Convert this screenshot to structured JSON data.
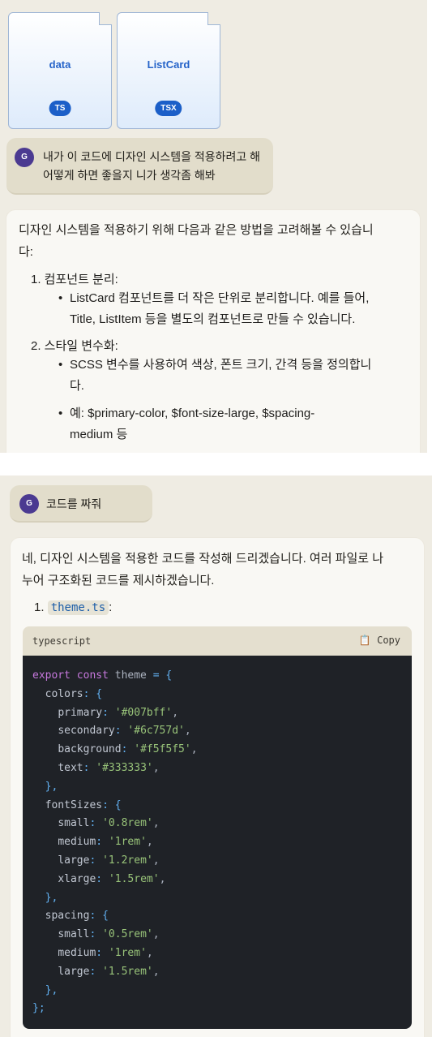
{
  "top": {
    "files": [
      {
        "name": "data",
        "type": "TS"
      },
      {
        "name": "ListCard",
        "type": "TSX"
      }
    ],
    "user_message": {
      "avatar": "G",
      "line1": "내가 이 코드에 디자인 시스템을 적용하려고 해",
      "line2": "어떻게 하면 좋을지 니가 생각좀 해봐"
    },
    "answer": {
      "intro_line1": "디자인 시스템을 적용하기 위해 다음과 같은 방법을 고려해볼 수 있습니",
      "intro_line2": "다:",
      "steps": [
        {
          "title": "1. 컴포넌트 분리:",
          "bullets": [
            [
              "ListCard 컴포넌트를 더 작은 단위로 분리합니다. 예를 들어,",
              "Title, ListItem 등을 별도의 컴포넌트로 만들 수 있습니다."
            ]
          ]
        },
        {
          "title": "2. 스타일 변수화:",
          "bullets": [
            [
              "SCSS 변수를 사용하여 색상, 폰트 크기, 간격 등을 정의합니",
              "다."
            ],
            [
              "예: $primary-color, $font-size-large, $spacing-",
              "medium 등"
            ]
          ]
        }
      ]
    }
  },
  "bottom": {
    "user_message": {
      "avatar": "G",
      "text": "코드를 짜줘"
    },
    "answer": {
      "intro_line1": "네, 디자인 시스템을 적용한 코드를 작성해 드리겠습니다. 여러 파일로 나",
      "intro_line2": "누어 구조화된 코드를 제시하겠습니다.",
      "step_number": "1.",
      "step_file": "theme.ts",
      "step_suffix": ":",
      "code": {
        "language": "typescript",
        "copy_label": "Copy",
        "lines": [
          "export const theme = {",
          "  colors: {",
          "    primary: '#007bff',",
          "    secondary: '#6c757d',",
          "    background: '#f5f5f5',",
          "    text: '#333333',",
          "  },",
          "  fontSizes: {",
          "    small: '0.8rem',",
          "    medium: '1rem',",
          "    large: '1.2rem',",
          "    xlarge: '1.5rem',",
          "  },",
          "  spacing: {",
          "    small: '0.5rem',",
          "    medium: '1rem',",
          "    large: '1.5rem',",
          "  },",
          "};"
        ]
      }
    }
  },
  "colors": {
    "panel_bg": "#efece3",
    "avatar": "#4b3a91",
    "file_badge": "#1c5fc8",
    "code_bg": "#1f2227"
  }
}
